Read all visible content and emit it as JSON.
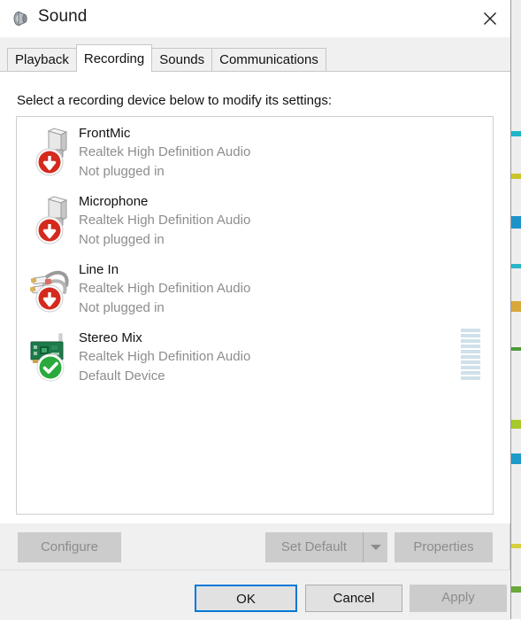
{
  "window": {
    "title": "Sound",
    "icon": "speaker-icon",
    "close_label": "✕"
  },
  "tabs": [
    {
      "label": "Playback",
      "selected": false
    },
    {
      "label": "Recording",
      "selected": true
    },
    {
      "label": "Sounds",
      "selected": false
    },
    {
      "label": "Communications",
      "selected": false
    }
  ],
  "panel": {
    "instruction": "Select a recording device below to modify its settings:"
  },
  "devices": [
    {
      "name": "FrontMic",
      "description": "Realtek High Definition Audio",
      "status": "Not plugged in",
      "icon": "microphone-jack-icon",
      "badge": "red-down-arrow-badge",
      "meter_segments": 0
    },
    {
      "name": "Microphone",
      "description": "Realtek High Definition Audio",
      "status": "Not plugged in",
      "icon": "microphone-jack-icon",
      "badge": "red-down-arrow-badge",
      "meter_segments": 0
    },
    {
      "name": "Line In",
      "description": "Realtek High Definition Audio",
      "status": "Not plugged in",
      "icon": "rca-cable-icon",
      "badge": "red-down-arrow-badge",
      "meter_segments": 0
    },
    {
      "name": "Stereo Mix",
      "description": "Realtek High Definition Audio",
      "status": "Default Device",
      "icon": "sound-card-icon",
      "badge": "green-check-badge",
      "meter_segments": 10
    }
  ],
  "panel_buttons": {
    "configure": "Configure",
    "set_default": "Set Default",
    "set_default_arrow": "chevron-down-icon",
    "properties": "Properties"
  },
  "footer_buttons": {
    "ok": "OK",
    "cancel": "Cancel",
    "apply": "Apply"
  },
  "colors": {
    "accent_focus": "#0078d7",
    "disabled_button_bg": "#cccccc",
    "disabled_button_text": "#8c8c8c",
    "enabled_button_bg": "#e1e1e1",
    "meter_segment": "#cfe1e9",
    "status_text": "#8d8d8d",
    "badge_red": "#d42a1e",
    "badge_green": "#2aaa3c",
    "dialog_bg": "#f0f0f0",
    "panel_bg": "#ffffff"
  }
}
